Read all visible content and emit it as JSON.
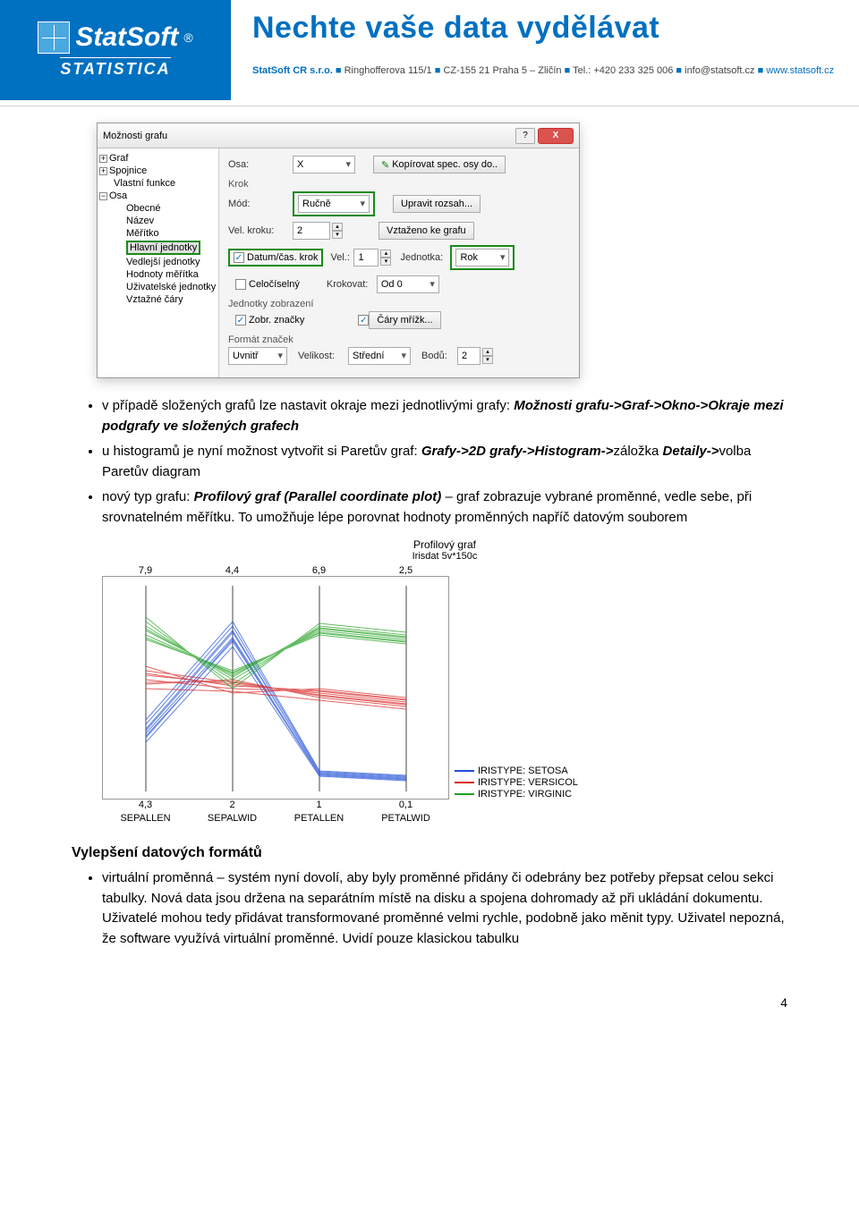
{
  "header": {
    "logo_name": "StatSoft",
    "logo_sub": "STATISTICA",
    "slogan": "Nechte vaše data vydělávat",
    "contact_prefix": "StatSoft CR s.r.o.",
    "contact_addr": "Ringhofferova 115/1",
    "contact_zip": "CZ-155 21 Praha 5 – Zličín",
    "contact_tel_label": "Tel.:",
    "contact_tel": "+420 233 325 006",
    "contact_email": "info@statsoft.cz",
    "contact_web": "www.statsoft.cz"
  },
  "dialog": {
    "title": "Možnosti grafu",
    "help_icon": "?",
    "close_icon": "X",
    "tree": {
      "n1": "Graf",
      "n2": "Spojnice",
      "n3": "Vlastní funkce",
      "n4": "Osa",
      "n4a": "Obecné",
      "n4b": "Název",
      "n4c": "Měřítko",
      "n4d": "Hlavní jednotky",
      "n4e": "Vedlejší jednotky",
      "n4f": "Hodnoty měřítka",
      "n4g": "Uživatelské jednotky",
      "n4h": "Vztažné čáry"
    },
    "form": {
      "osa_label": "Osa:",
      "osa_value": "X",
      "kopirovat_btn": "Kopírovat spec. osy do..",
      "krok_section": "Krok",
      "mod_label": "Mód:",
      "mod_value": "Ručně",
      "upravit_btn": "Upravit rozsah...",
      "velkroku_label": "Vel. kroku:",
      "velkroku_value": "2",
      "vztazeno_btn": "Vztaženo ke grafu",
      "datum_chk": "Datum/čas. krok",
      "vel_label": "Vel.:",
      "vel_value": "1",
      "jednotka_label": "Jednotka:",
      "jednotka_value": "Rok",
      "celociselny_chk": "Celočíselný",
      "krokovat_label": "Krokovat:",
      "krokovat_value": "Od 0",
      "jednotky_section": "Jednotky zobrazení",
      "zobr_chk": "Zobr. značky",
      "cary_chk": "Čáry mřížk...",
      "format_section": "Formát značek",
      "uvnitr_value": "Uvnitř",
      "velikost_label": "Velikost:",
      "velikost_value": "Střední",
      "bodu_label": "Bodů:",
      "bodu_value": "2"
    }
  },
  "bullets": {
    "b1_text_a": "v případě složených grafů lze nastavit okraje mezi jednotlivými grafy: ",
    "b1_italic": "Možnosti grafu->Graf->Okno->Okraje mezi podgrafy ve složených grafech",
    "b2_text_a": "u histogramů je nyní možnost vytvořit si Paretův graf: ",
    "b2_italic": "Grafy->2D grafy->Histogram->",
    "b2_text_b": "záložka ",
    "b2_italic2": "Detaily->",
    "b2_text_c": "volba Paretův diagram",
    "b3_text_a": "nový typ grafu: ",
    "b3_italic": "Profilový graf (Parallel coordinate plot)",
    "b3_text_b": " – graf zobrazuje vybrané proměnné, vedle sebe, při srovnatelném měřítku. To umožňuje lépe porovnat hodnoty proměnných napříč datovým souborem"
  },
  "chart_data": {
    "type": "line",
    "title": "Profilový graf",
    "subtitle": "Irisdat 5v*150c",
    "categories": [
      "SEPALLEN",
      "SEPALWID",
      "PETALLEN",
      "PETALWID"
    ],
    "top_axis_values": [
      "7,9",
      "4,4",
      "6,9",
      "2,5"
    ],
    "bottom_axis_values": [
      "4,3",
      "2",
      "1",
      "0,1"
    ],
    "series": [
      {
        "name": "IRISTYPE: SETOSA",
        "color": "#2050d8"
      },
      {
        "name": "IRISTYPE: VERSICOL",
        "color": "#d82020"
      },
      {
        "name": "IRISTYPE: VIRGINIC",
        "color": "#20a020"
      }
    ]
  },
  "section2": {
    "title": "Vylepšení datových formátů",
    "bullet": "virtuální proměnná – systém nyní dovolí, aby byly proměnné přidány či odebrány bez potřeby přepsat celou sekci tabulky. Nová data jsou držena na separátním místě na disku a spojena dohromady až při ukládání dokumentu. Uživatelé mohou tedy přidávat transformované proměnné velmi rychle, podobně jako měnit typy. Uživatel nepozná, že software využívá virtuální proměnné. Uvidí pouze klasickou tabulku"
  },
  "page_number": "4"
}
